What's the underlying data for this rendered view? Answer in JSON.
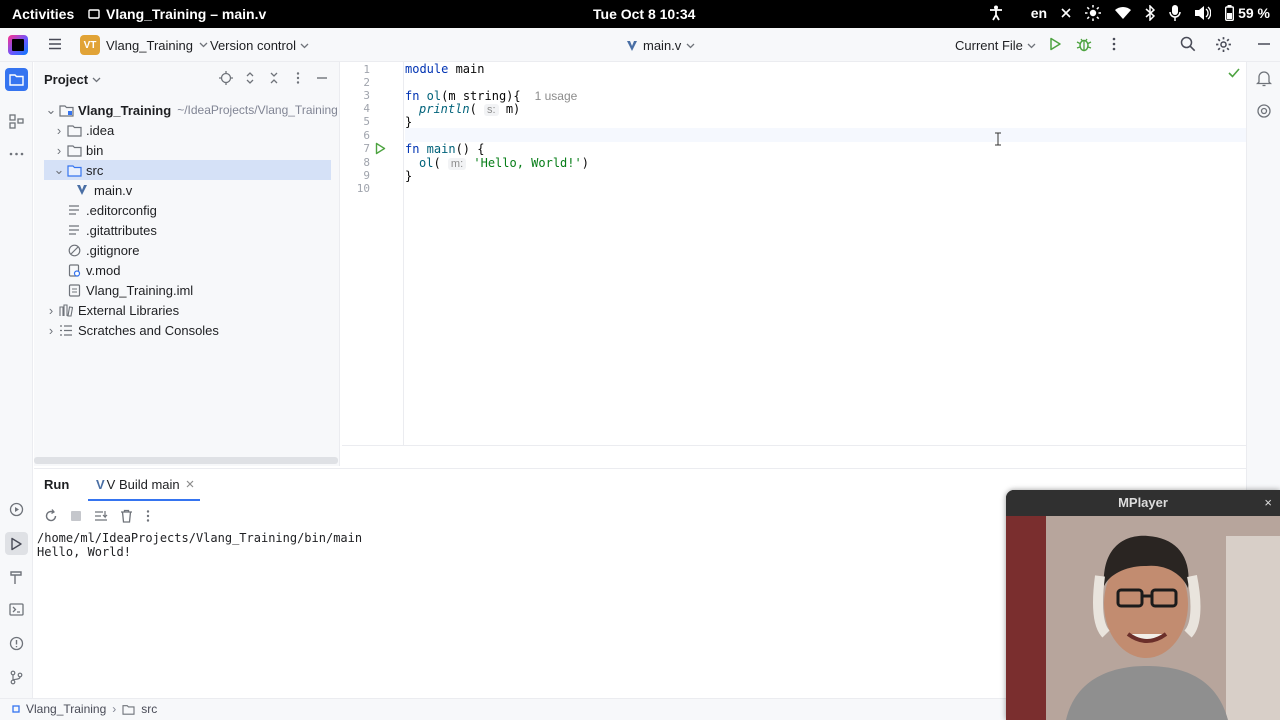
{
  "topbar": {
    "activities": "Activities",
    "app_title": "Vlang_Training – main.v",
    "clock": "Tue Oct 8  10:34",
    "lang": "en",
    "battery": "59 %"
  },
  "toolbar": {
    "project_badge": "VT",
    "project_name": "Vlang_Training",
    "vcs": "Version control",
    "file_tab": "main.v",
    "run_config": "Current File"
  },
  "project_panel": {
    "title": "Project",
    "root_name": "Vlang_Training",
    "root_path": "~/IdeaProjects/Vlang_Training",
    "items": [
      {
        "label": ".idea"
      },
      {
        "label": "bin"
      },
      {
        "label": "src"
      },
      {
        "label": "main.v"
      },
      {
        "label": ".editorconfig"
      },
      {
        "label": ".gitattributes"
      },
      {
        "label": ".gitignore"
      },
      {
        "label": "v.mod"
      },
      {
        "label": "Vlang_Training.iml"
      },
      {
        "label": "External Libraries"
      },
      {
        "label": "Scratches and Consoles"
      }
    ]
  },
  "editor": {
    "line_numbers": [
      "1",
      "2",
      "3",
      "4",
      "5",
      "6",
      "7",
      "8",
      "9",
      "10"
    ],
    "kw_module": "module",
    "module_name": " main",
    "kw_fn": "fn",
    "fn_ol": " ol",
    "ol_params": "(m string){",
    "usage_hint": "1 usage",
    "println": "println",
    "println_open": "( ",
    "hint_s": "s:",
    "println_arg": " m)",
    "close_brace": "}",
    "fn_main": " main",
    "main_rest": "() {",
    "ol_call": "ol",
    "ol_call_open": "( ",
    "hint_m": "m:",
    "hello_str": " 'Hello, World!'",
    "call_close": ")"
  },
  "run_panel": {
    "label": "Run",
    "tab_icon": "V",
    "tab_label": "V Build main",
    "console_line1": "/home/ml/IdeaProjects/Vlang_Training/bin/main",
    "console_line2": "Hello, World!"
  },
  "statusbar": {
    "crumb1": "Vlang_Training",
    "crumb2": "src"
  },
  "mplayer": {
    "title": "MPlayer",
    "close": "×"
  },
  "colors": {
    "accent": "#3574f0",
    "run_green": "#4da340",
    "keyword": "#0033b3",
    "string": "#067d17"
  }
}
